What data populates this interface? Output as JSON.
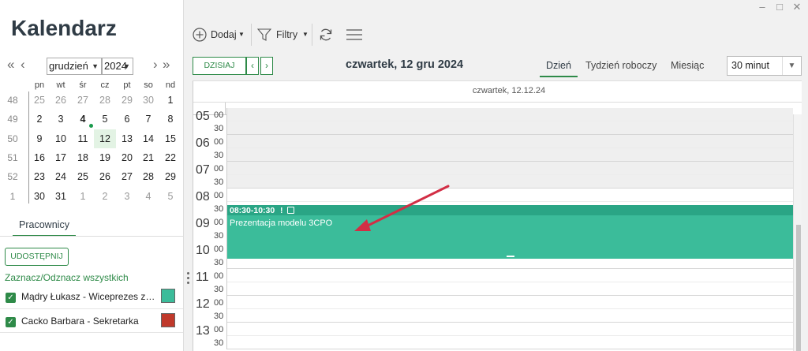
{
  "app": {
    "title": "Kalendarz"
  },
  "window": {
    "minimize": "–",
    "maximize": "□",
    "close": "✕"
  },
  "mini_calendar": {
    "prev_year": "«",
    "prev_month": "‹",
    "next_month": "›",
    "next_year": "»",
    "month": "grudzień",
    "year": "2024",
    "weekdays": [
      "pn",
      "wt",
      "śr",
      "cz",
      "pt",
      "so",
      "nd"
    ],
    "weeks": [
      {
        "num": "48",
        "days": [
          "25",
          "26",
          "27",
          "28",
          "29",
          "30",
          "1"
        ]
      },
      {
        "num": "49",
        "days": [
          "2",
          "3",
          "4",
          "5",
          "6",
          "7",
          "8"
        ]
      },
      {
        "num": "50",
        "days": [
          "9",
          "10",
          "11",
          "12",
          "13",
          "14",
          "15"
        ]
      },
      {
        "num": "51",
        "days": [
          "16",
          "17",
          "18",
          "19",
          "20",
          "21",
          "22"
        ]
      },
      {
        "num": "52",
        "days": [
          "23",
          "24",
          "25",
          "26",
          "27",
          "28",
          "29"
        ]
      },
      {
        "num": "1",
        "days": [
          "30",
          "31",
          "1",
          "2",
          "3",
          "4",
          "5"
        ]
      }
    ],
    "selected_day": "12",
    "day_with_event": "4"
  },
  "employees_panel": {
    "tab_label": "Pracownicy",
    "share_button": "UDOSTĘPNIJ",
    "toggle_all": "Zaznacz/Odznacz wszystkich",
    "employees": [
      {
        "name": "Mądry Łukasz - Wiceprezes zarządu",
        "checked": true,
        "color": "#3bbc9a"
      },
      {
        "name": "Cacko Barbara - Sekretarka",
        "checked": true,
        "color": "#c0392b"
      }
    ]
  },
  "toolbar": {
    "add_label": "Dodaj",
    "filters_label": "Filtry",
    "add_icon": "plus-circle-icon",
    "filter_icon": "funnel-icon",
    "refresh_icon": "refresh-icon",
    "menu_icon": "hamburger-icon"
  },
  "navigation": {
    "today_button": "DZISIAJ",
    "prev": "‹",
    "next": "›",
    "current_date": "czwartek, 12 gru 2024"
  },
  "views": {
    "day": "Dzień",
    "work_week": "Tydzień roboczy",
    "month": "Miesiąc",
    "active": "day"
  },
  "interval": {
    "value": "30 minut"
  },
  "day_view": {
    "header": "czwartek, 12.12.24",
    "hours": [
      "05",
      "06",
      "07",
      "08",
      "09",
      "10",
      "11",
      "12",
      "13"
    ],
    "half_label": "30",
    "full_label": "00"
  },
  "event": {
    "time": "08:30-10:30",
    "flag": "!",
    "title": "Prezentacja modelu 3CPO",
    "color": "#3bbc9a"
  }
}
